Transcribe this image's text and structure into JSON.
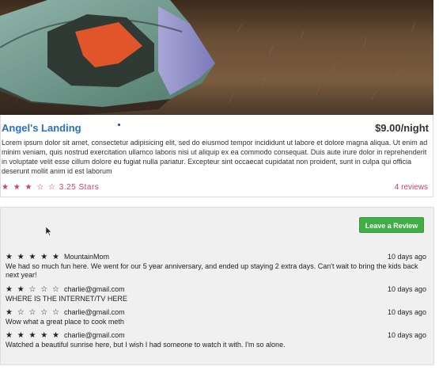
{
  "listing": {
    "title": "Angel's Landing",
    "price": "$9.00/night",
    "description": "Lorem ipsum dolor sit amet, consectetur adipisicing elit, sed do eiusmod tempor incididunt ut labore et dolore magna aliqua. Ut enim ad minim veniam, quis nostrud exercitation ullamco laboris nisi ut aliquip ex ea commodo consequat. Duis aute irure dolor in reprehenderit in voluptate velit esse cillum dolore eu fugiat nulla pariatur. Excepteur sint occaecat cupidatat non proident, sunt in culpa qui officia deserunt mollit anim id est laborum",
    "rating_stars": "★ ★ ★ ☆ ☆",
    "rating_label": "3.25 Stars",
    "reviews_count": "4 reviews",
    "accent_color": "#2a6fbd",
    "rating_color": "#c9405f"
  },
  "reviews_panel": {
    "leave_review_label": "Leave a Review",
    "button_color": "#3fae46",
    "items": [
      {
        "stars": "★ ★ ★ ★ ★",
        "author": "MountainMom",
        "time": "10 days ago",
        "body": "We had so much fun here. We went for our 5 year anniversary, and ended up staying 2 extra days. Can't wait to bring the kids back next year!"
      },
      {
        "stars": "★ ★ ☆ ☆ ☆",
        "author": "charlie@gmail.com",
        "time": "10 days ago",
        "body": "WHERE IS THE INTERNET/TV HERE"
      },
      {
        "stars": "★ ☆ ☆ ☆ ☆",
        "author": "charlie@gmail.com",
        "time": "10 days ago",
        "body": "Wow what a great place to cook meth"
      },
      {
        "stars": "★ ★ ★ ★ ★",
        "author": "charlie@gmail.com",
        "time": "10 days ago",
        "body": "Watched a beautiful sunrise here, but I wish I had someone to watch it with. I'm so alone."
      }
    ]
  }
}
